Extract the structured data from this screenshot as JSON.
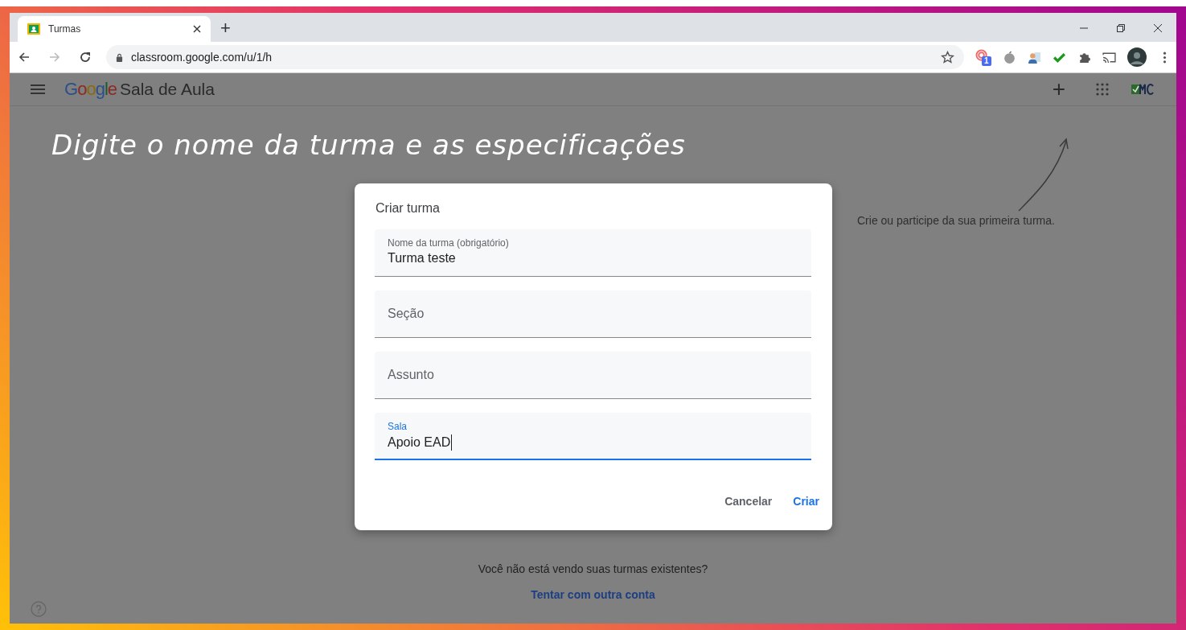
{
  "browser": {
    "tab": {
      "title": "Turmas"
    },
    "new_tab": "+",
    "address": "classroom.google.com/u/1/h",
    "extension_badge": "1"
  },
  "app_bar": {
    "logo": "Google",
    "title": "Sala de Aula",
    "add": "+"
  },
  "annotation": "Digite o nome da turma e as especificações",
  "hint": "Crie ou participe da sua primeira turma.",
  "dialog": {
    "title": "Criar turma",
    "fields": [
      {
        "label": "Nome da turma (obrigatório)",
        "value": "Turma teste",
        "focused": false
      },
      {
        "placeholder": "Seção",
        "focused": false
      },
      {
        "placeholder": "Assunto",
        "focused": false
      },
      {
        "label": "Sala",
        "value": "Apoio EAD",
        "focused": true
      }
    ],
    "buttons": [
      {
        "label": "Cancelar",
        "kind": "secondary"
      },
      {
        "label": "Criar",
        "kind": "primary"
      }
    ]
  },
  "footer": {
    "question": "Você não está vendo suas turmas existentes?",
    "link": "Tentar com outra conta"
  }
}
